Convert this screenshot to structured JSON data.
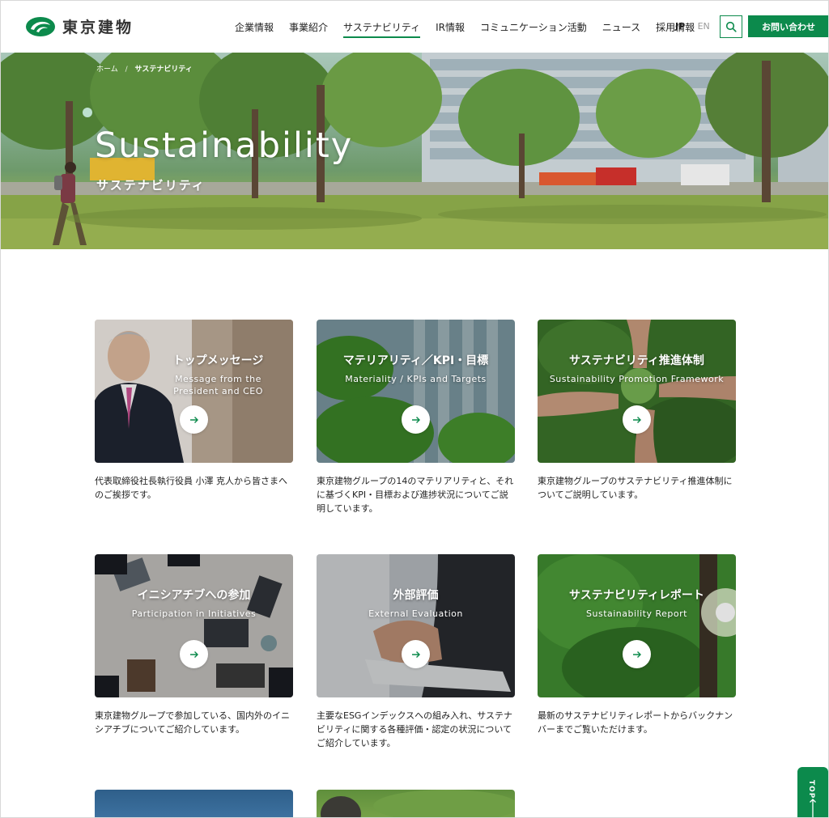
{
  "header": {
    "logo_text": "東京建物",
    "nav": [
      {
        "label": "企業情報",
        "active": false
      },
      {
        "label": "事業紹介",
        "active": false
      },
      {
        "label": "サステナビリティ",
        "active": true
      },
      {
        "label": "IR情報",
        "active": false
      },
      {
        "label": "コミュニケーション活動",
        "active": false
      },
      {
        "label": "ニュース",
        "active": false
      },
      {
        "label": "採用情報",
        "active": false
      }
    ],
    "lang_jp": "JP",
    "lang_sep": "/",
    "lang_en": "EN",
    "search_icon": "search-icon",
    "contact_label": "お問い合わせ"
  },
  "hero": {
    "breadcrumb_home": "ホーム",
    "breadcrumb_sep": "/",
    "breadcrumb_current": "サステナビリティ",
    "title": "Sustainability",
    "subtitle": "サステナビリティ"
  },
  "cards": [
    {
      "title": "トップメッセージ",
      "en1": "Message from the",
      "en2": "President and CEO",
      "desc": "代表取締役社長執行役員 小澤 克人から皆さまへのご挨拶です。"
    },
    {
      "title": "マテリアリティ／KPI・目標",
      "en1": "Materiality / KPIs and Targets",
      "en2": "",
      "desc": "東京建物グループの14のマテリアリティと、それに基づくKPI・目標および進捗状況についてご説明しています。"
    },
    {
      "title": "サステナビリティ推進体制",
      "en1": "Sustainability Promotion Framework",
      "en2": "",
      "desc": "東京建物グループのサステナビリティ推進体制についてご説明しています。"
    },
    {
      "title": "イニシアチブへの参加",
      "en1": "Participation in Initiatives",
      "en2": "",
      "desc": "東京建物グループで参加している、国内外のイニシアチブについてご紹介しています。"
    },
    {
      "title": "外部評価",
      "en1": "External Evaluation",
      "en2": "",
      "desc": "主要なESGインデックスへの組み入れ、サステナビリティに関する各種評価・認定の状況についてご紹介しています。"
    },
    {
      "title": "サステナビリティレポート",
      "en1": "Sustainability Report",
      "en2": "",
      "desc": "最新のサステナビリティレポートからバックナンバーまでご覧いただけます。"
    }
  ],
  "top_button": {
    "label": "TOP"
  },
  "colors": {
    "accent": "#0c8a4c"
  }
}
